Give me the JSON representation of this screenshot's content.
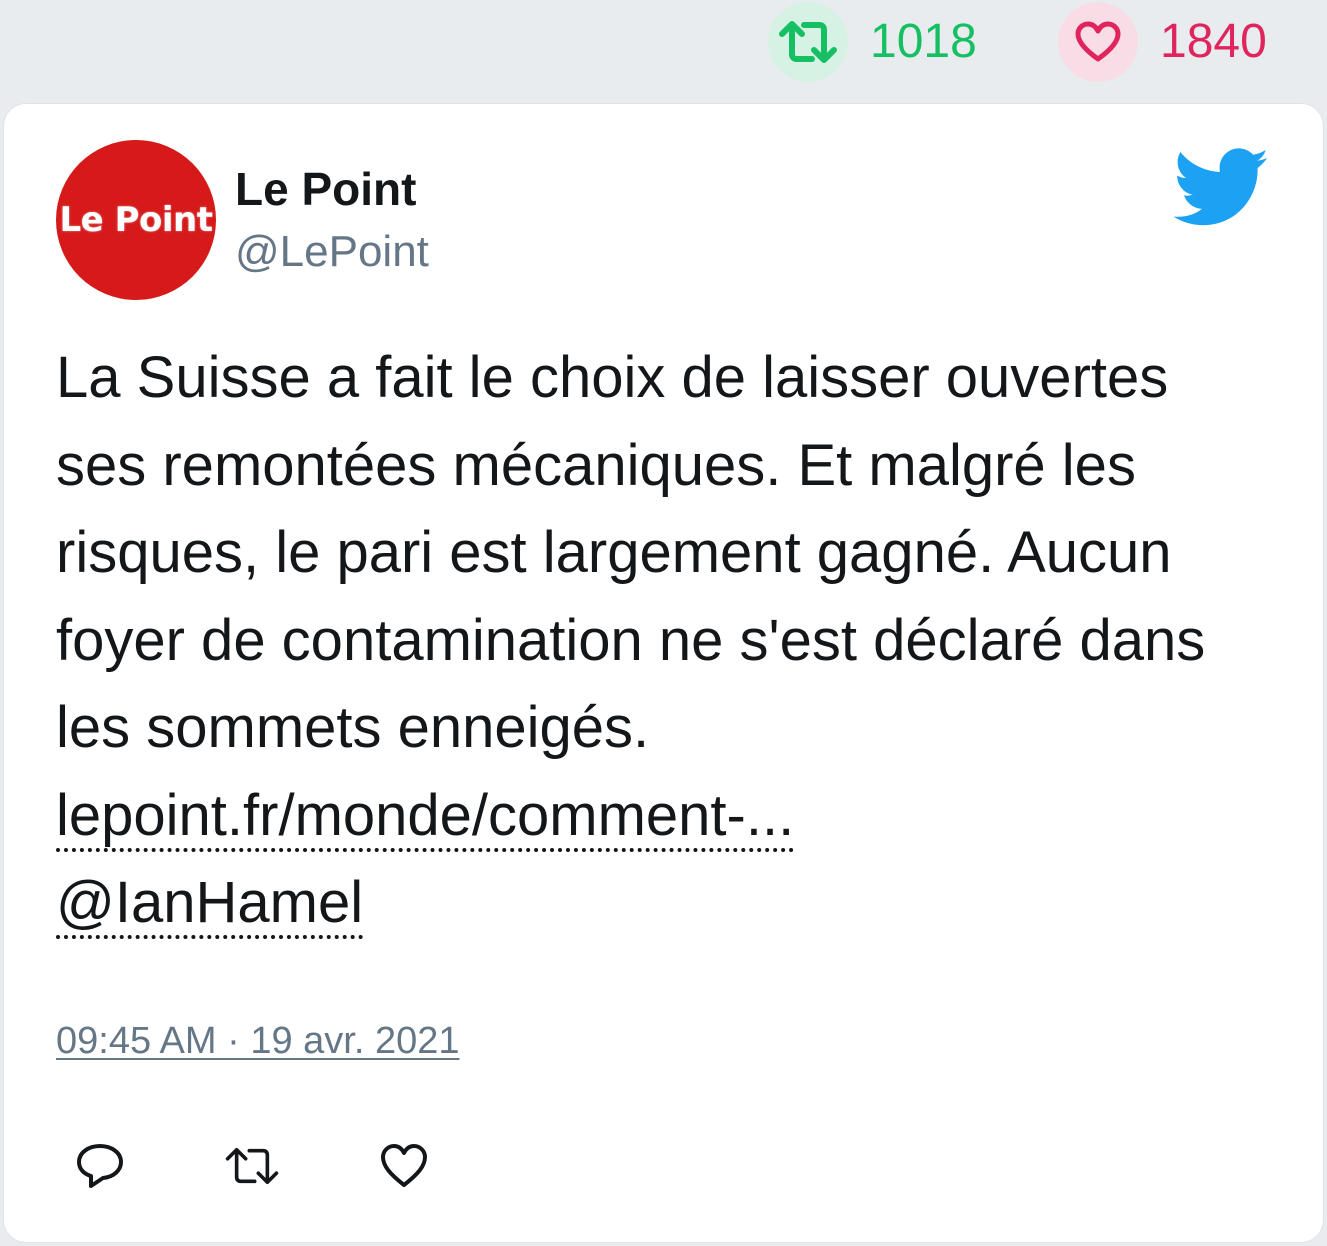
{
  "stats": {
    "retweets": "1018",
    "likes": "1840",
    "retweet_color": "#17bf63",
    "like_color": "#e0245e"
  },
  "tweet": {
    "avatar_text": "Le Point",
    "display_name": "Le Point",
    "handle": "@LePoint",
    "text": "La Suisse a fait le choix de laisser ouvertes ses remontées mécaniques. Et malgré les risques, le pari est largement gagné. Aucun foyer de contamination ne s'est déclaré dans les sommets enneigés. ",
    "link": "lepoint.fr/monde/comment-...",
    "mention": "@IanHamel",
    "timestamp": "09:45 AM · 19 avr. 2021"
  },
  "icons": {
    "brand": "twitter-bird-icon",
    "actions": [
      "reply-icon",
      "retweet-icon",
      "like-icon"
    ]
  }
}
